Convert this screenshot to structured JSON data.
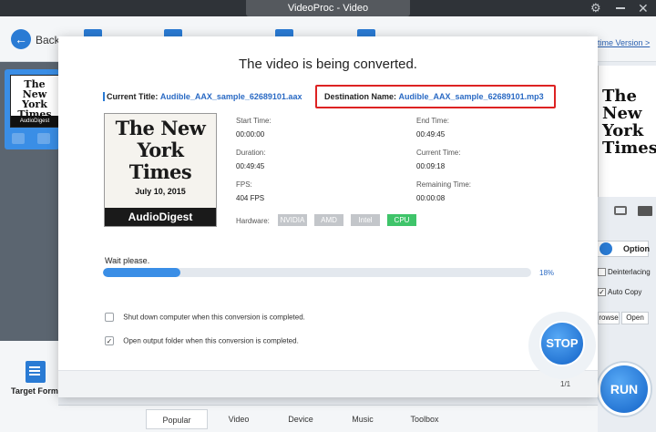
{
  "window": {
    "title": "VideoProc - Video"
  },
  "toolbar": {
    "back_label": "Back",
    "version_link": "time Version >"
  },
  "left_panel": {
    "thumb_title": "The New York Times",
    "thumb_brand": "AudioDigest",
    "target_format_label": "Target Format"
  },
  "right_panel": {
    "thumb_title": "The New York Times",
    "option_label": "Option",
    "deinterlacing_label": "Deinterlacing",
    "auto_copy_label": "Auto Copy",
    "auto_copy_checked": true,
    "browse_label": "rowse",
    "open_label": "Open",
    "run_label": "RUN"
  },
  "bottom_tabs": [
    {
      "label": "Popular",
      "active": true
    },
    {
      "label": "Video",
      "active": false
    },
    {
      "label": "Device",
      "active": false
    },
    {
      "label": "Music",
      "active": false
    },
    {
      "label": "Toolbox",
      "active": false
    }
  ],
  "dialog": {
    "title": "The video is being converted.",
    "current_title_key": "Current Title:",
    "current_title_value": "Audible_AAX_sample_62689101.aax",
    "destination_key": "Destination Name:",
    "destination_value": "Audible_AAX_sample_62689101.mp3",
    "cover": {
      "title": "The New York Times",
      "date": "July 10, 2015",
      "brand": "AudioDigest"
    },
    "stats": {
      "start_time_label": "Start Time:",
      "start_time": "00:00:00",
      "end_time_label": "End Time:",
      "end_time": "00:49:45",
      "duration_label": "Duration:",
      "duration": "00:49:45",
      "current_time_label": "Current Time:",
      "current_time": "00:09:18",
      "fps_label": "FPS:",
      "fps": "404 FPS",
      "remaining_label": "Remaining Time:",
      "remaining": "00:00:08"
    },
    "hardware_label": "Hardware:",
    "hardware": [
      {
        "label": "NVIDIA",
        "active": false
      },
      {
        "label": "AMD",
        "active": false
      },
      {
        "label": "Intel",
        "active": false
      },
      {
        "label": "CPU",
        "active": true
      }
    ],
    "wait_label": "Wait please.",
    "progress_percent": 18,
    "progress_text": "18%",
    "options": [
      {
        "label": "Shut down computer when this conversion is completed.",
        "checked": false
      },
      {
        "label": "Open output folder when this conversion is completed.",
        "checked": true
      }
    ],
    "stop_label": "STOP",
    "page_indicator": "1/1"
  },
  "colors": {
    "accent": "#2a7bd4",
    "progress": "#3a8ee6",
    "cpu_active": "#3fc46a",
    "highlight_box": "#dd2222"
  }
}
